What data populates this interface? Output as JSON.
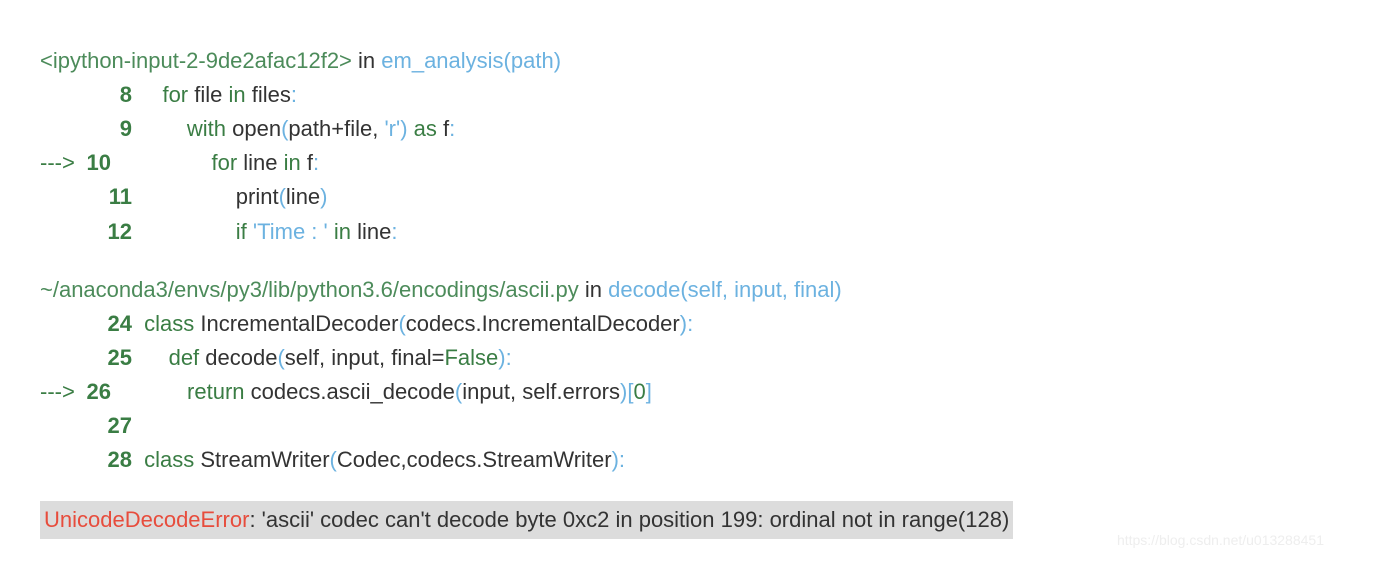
{
  "frame1": {
    "location": "<ipython-input-2-9de2afac12f2>",
    "in": " in ",
    "func": "em_analysis",
    "args": "path",
    "lines": [
      {
        "no": "8",
        "arrow": "      ",
        "code_pre": "    ",
        "kw1": "for",
        "t1": " file ",
        "kw2": "in",
        "t2": " files",
        "colon": ":",
        "rest": ""
      },
      {
        "no": "9",
        "arrow": "      ",
        "code_pre": "        ",
        "kw1": "with",
        "t1": " open",
        "paren": "(",
        "t2": "path",
        "op": "+",
        "t3": "file",
        "comma": ", ",
        "str": "'r'",
        "paren2": ")",
        "t4": " ",
        "kw2": "as",
        "t5": " f",
        "colon": ":"
      },
      {
        "no": "10",
        "arrow": "---> ",
        "code_pre": "             ",
        "kw1": "for",
        "t1": " line ",
        "kw2": "in",
        "t2": " f",
        "colon": ":"
      },
      {
        "no": "11",
        "arrow": "      ",
        "code_pre": "                print",
        "paren": "(",
        "t1": "line",
        "paren2": ")"
      },
      {
        "no": "12",
        "arrow": "      ",
        "code_pre": "                ",
        "kw1": "if",
        "t1": " ",
        "str": "'Time : '",
        "t2": " ",
        "kw2": "in",
        "t3": " line",
        "colon": ":"
      }
    ]
  },
  "frame2": {
    "location": "~/anaconda3/envs/py3/lib/python3.6/encodings/ascii.py",
    "in": " in ",
    "func": "decode",
    "args": "self, input, final",
    "lines": [
      {
        "no": "24",
        "arrow": "     ",
        "kw1": "class",
        "t1": " IncrementalDecoder",
        "paren": "(",
        "t2": "codecs",
        "dot": ".",
        "t3": "IncrementalDecoder",
        "paren2": ")",
        "colon": ":"
      },
      {
        "no": "25",
        "arrow": "     ",
        "pre": "    ",
        "kw1": "def",
        "t1": " decode",
        "paren": "(",
        "t2": "self",
        "c1": ", ",
        "t3": "input",
        "c2": ", ",
        "t4": "final",
        "eq": "=",
        "false": "False",
        "paren2": ")",
        "colon": ":"
      },
      {
        "no": "26",
        "arrow": "---> ",
        "pre": "        ",
        "kw1": "return",
        "t1": " codecs",
        "dot": ".",
        "t2": "ascii_decode",
        "paren": "(",
        "t3": "input",
        "c1": ", ",
        "t4": "self",
        "dot2": ".",
        "t5": "errors",
        "paren2": ")",
        "br1": "[",
        "idx": "0",
        "br2": "]"
      },
      {
        "no": "27",
        "arrow": "     ",
        "pre": "",
        "t1": ""
      },
      {
        "no": "28",
        "arrow": "     ",
        "kw1": "class",
        "t1": " StreamWriter",
        "paren": "(",
        "t2": "Codec",
        "c1": ",",
        "t3": "codecs",
        "dot": ".",
        "t4": "StreamWriter",
        "paren2": ")",
        "colon": ":"
      }
    ]
  },
  "error": {
    "name": "UnicodeDecodeError",
    "msg": ": 'ascii' codec can't decode byte 0xc2 in position 199: ordinal not in range(128)"
  },
  "watermark": "https://blog.csdn.net/u013288451"
}
